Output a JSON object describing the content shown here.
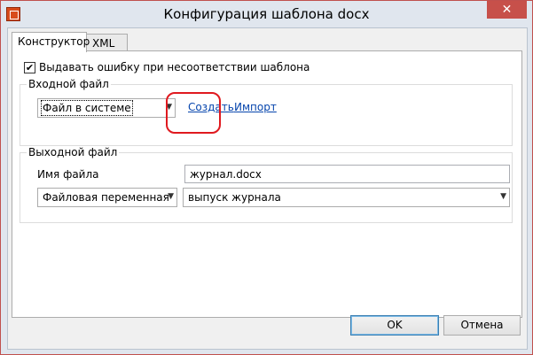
{
  "window": {
    "title": "Конфигурация шаблона docx",
    "close_glyph": "✕",
    "app_icon": "app-logo-icon"
  },
  "tabs": [
    {
      "label": "Конструктор",
      "active": true
    },
    {
      "label": "XML",
      "active": false
    }
  ],
  "error_checkbox": {
    "checked": true,
    "check_glyph": "✔",
    "label": "Выдавать ошибку при несоответствии шаблона"
  },
  "input_file": {
    "caption": "Входной файл",
    "source_select": {
      "value": "Файл в системе"
    },
    "create_link": "Создать",
    "import_link": "Импорт"
  },
  "output_file": {
    "caption": "Выходной файл",
    "filename_label": "Имя файла",
    "filename_value": "журнал.docx",
    "type_select": {
      "value": "Файловая переменная"
    },
    "variable_select": {
      "value": "выпуск журнала"
    }
  },
  "footer": {
    "ok_label": "OK",
    "cancel_label": "Отмена"
  },
  "colors": {
    "window_border": "#c0504d",
    "highlight": "#e0191f",
    "link": "#0645ad"
  }
}
